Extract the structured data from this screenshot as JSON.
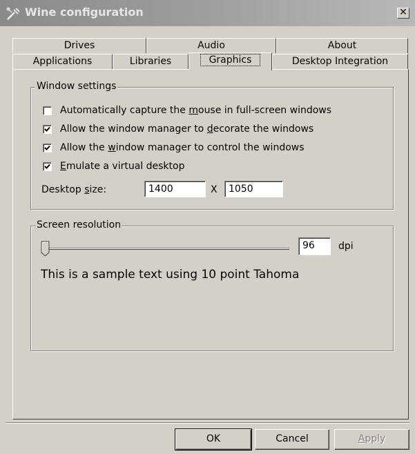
{
  "window": {
    "title": "Wine configuration",
    "close_label": "✕"
  },
  "tabs": {
    "row1": [
      "Drives",
      "Audio",
      "About"
    ],
    "row2": [
      "Applications",
      "Libraries",
      "Graphics",
      "Desktop Integration"
    ],
    "active": "Graphics"
  },
  "window_settings": {
    "legend": "Window settings",
    "capture_mouse": {
      "label_pre": "Automatically capture the ",
      "mnemonic": "m",
      "label_post": "ouse in full-screen windows",
      "checked": false
    },
    "decorate": {
      "label_pre": "Allow the window manager to ",
      "mnemonic": "d",
      "label_post": "ecorate the windows",
      "checked": true
    },
    "control": {
      "label_pre": "Allow the ",
      "mnemonic": "w",
      "label_post": "indow manager to control the windows",
      "checked": true
    },
    "emulate": {
      "label_pre": "",
      "mnemonic": "E",
      "label_post": "mulate a virtual desktop",
      "checked": true
    },
    "desktop_size": {
      "label_pre": "Desktop ",
      "mnemonic": "s",
      "label_post": "ize:",
      "width": "1400",
      "separator": "X",
      "height": "1050"
    }
  },
  "screen_resolution": {
    "legend": "Screen resolution",
    "slider_position": 0,
    "dpi_value": "96",
    "dpi_unit": "dpi",
    "sample_text": "This is a sample text using 10 point Tahoma"
  },
  "buttons": {
    "ok": "OK",
    "cancel": "Cancel",
    "apply": "Apply",
    "apply_enabled": false
  }
}
